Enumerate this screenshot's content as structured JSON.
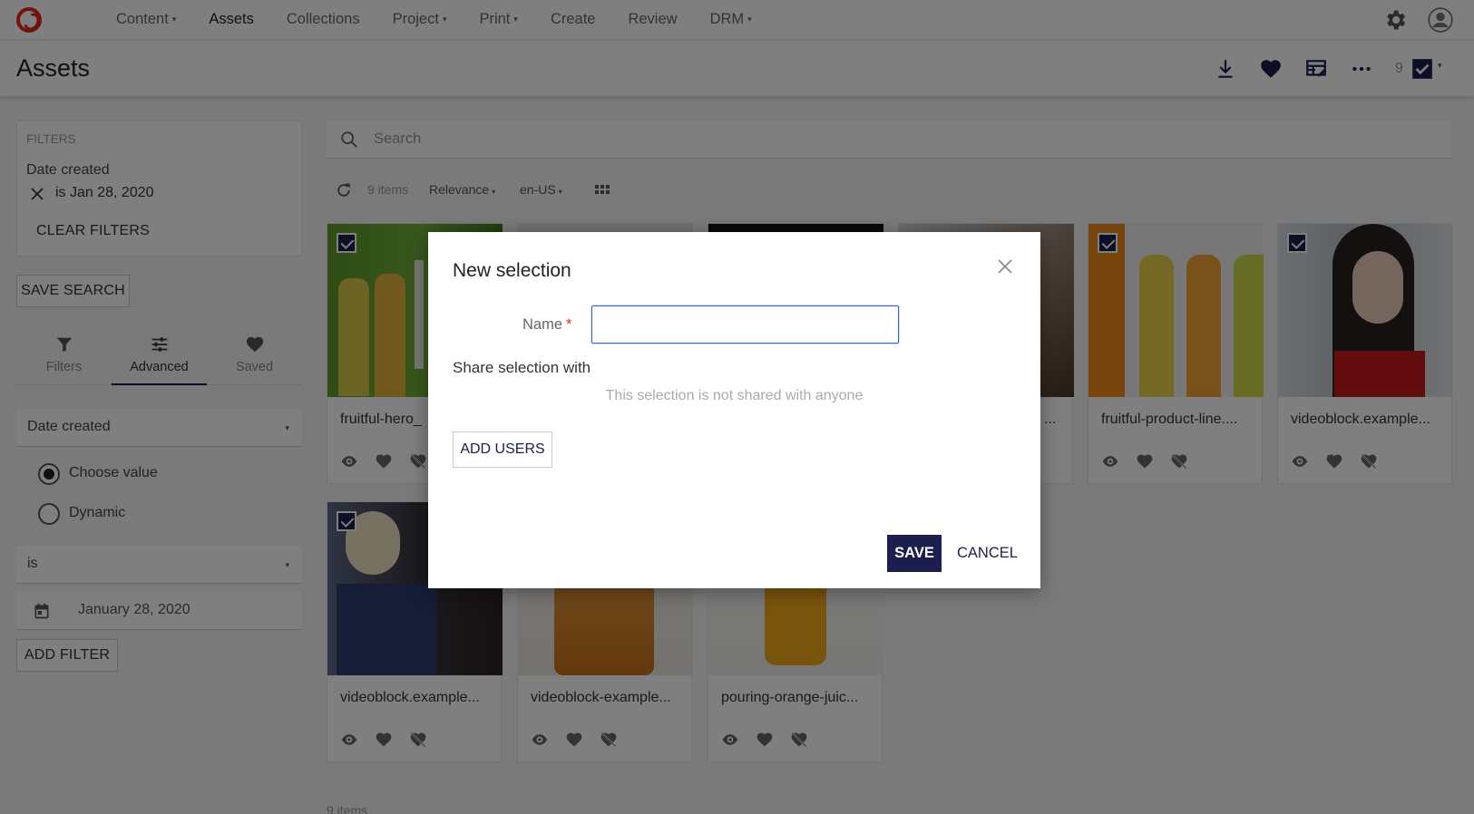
{
  "nav": {
    "items": [
      {
        "label": "Content",
        "dropdown": true
      },
      {
        "label": "Assets",
        "dropdown": false,
        "active": true
      },
      {
        "label": "Collections",
        "dropdown": false
      },
      {
        "label": "Project",
        "dropdown": true
      },
      {
        "label": "Print",
        "dropdown": true
      },
      {
        "label": "Create",
        "dropdown": false
      },
      {
        "label": "Review",
        "dropdown": false
      },
      {
        "label": "DRM",
        "dropdown": true
      }
    ],
    "caret": "▾"
  },
  "header": {
    "title": "Assets",
    "selected_count": "9"
  },
  "sidebar": {
    "filters_label": "FILTERS",
    "active_filter_field": "Date created",
    "active_filter_value": "is Jan 28, 2020",
    "clear_filters": "CLEAR FILTERS",
    "save_search": "SAVE SEARCH",
    "tabs": [
      {
        "label": "Filters",
        "icon": "funnel-icon"
      },
      {
        "label": "Advanced",
        "icon": "sliders-icon",
        "active": true
      },
      {
        "label": "Saved",
        "icon": "heart-icon"
      }
    ],
    "field_select": "Date created",
    "radio_choose": "Choose value",
    "radio_dynamic": "Dynamic",
    "operator_select": "is",
    "date_value": "January 28, 2020",
    "add_filter": "ADD FILTER"
  },
  "search": {
    "placeholder": "Search"
  },
  "toolbar": {
    "count": "9 items",
    "sort": "Relevance",
    "locale": "en-US"
  },
  "cards": [
    {
      "name": "fruitful-hero_",
      "checked": true
    },
    {
      "name": "",
      "checked": true
    },
    {
      "name": "",
      "checked": false
    },
    {
      "name": "...",
      "checked": true
    },
    {
      "name": "fruitful-product-line....",
      "checked": true
    },
    {
      "name": "videoblock.example...",
      "checked": true
    },
    {
      "name": "videoblock.example...",
      "checked": true
    },
    {
      "name": "videoblock-example...",
      "checked": false
    },
    {
      "name": "pouring-orange-juic...",
      "checked": false
    }
  ],
  "footer": {
    "count": "9 items"
  },
  "modal": {
    "title": "New selection",
    "name_label": "Name",
    "required_mark": "*",
    "name_value": "",
    "share_label": "Share selection with",
    "empty_share": "This selection is not shared with anyone",
    "add_users": "ADD USERS",
    "save": "SAVE",
    "cancel": "CANCEL"
  },
  "colors": {
    "brand_red": "#e02b1d",
    "primary_navy": "#1a1f4e",
    "focus_blue": "#3b6fc7"
  }
}
